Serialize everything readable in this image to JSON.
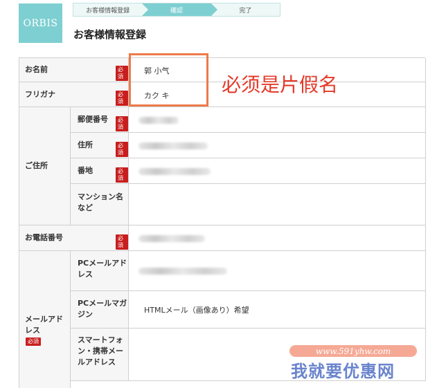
{
  "brand": {
    "logo_text": "ORBIS"
  },
  "steps": [
    "お客様情報登録",
    "確認",
    "完了"
  ],
  "page_title": "お客様情報登録",
  "required_badge": "必須",
  "form": {
    "name": {
      "label": "お名前",
      "value": "郭 小气"
    },
    "furigana": {
      "label": "フリガナ",
      "value": "カク キ"
    },
    "address": {
      "label": "ご住所",
      "postal": {
        "label": "郵便番号"
      },
      "jusho": {
        "label": "住所"
      },
      "banchi": {
        "label": "番地"
      },
      "building": {
        "label": "マンション名など"
      }
    },
    "phone": {
      "label": "お電話番号"
    },
    "email": {
      "label": "メールアドレス",
      "pc": {
        "label": "PCメールアドレス"
      },
      "magazine": {
        "label": "PCメールマガジン",
        "value": "HTMLメール（画像あり）希望"
      },
      "mobile": {
        "label": "スマートフォン・携帯メールアドレス"
      }
    }
  },
  "annotation": {
    "text": "必须是片假名"
  },
  "watermark": {
    "url": "www.591yhw.com",
    "name": "我就要优惠网"
  },
  "colors": {
    "accent": "#7ecfd1",
    "required": "#c81e1e",
    "annotation": "#e43a2a",
    "highlight": "#ee7a4a"
  }
}
